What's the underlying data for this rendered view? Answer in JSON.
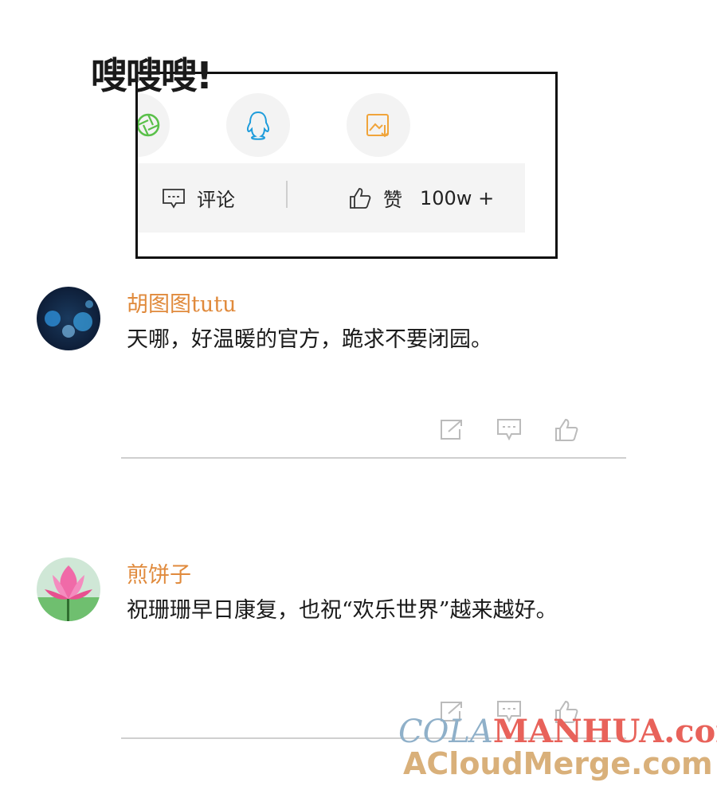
{
  "sfx_text": "嗖嗖嗖!",
  "share_panel": {
    "icons": [
      "wechat-moments-icon",
      "qq-icon",
      "save-image-icon"
    ],
    "comment_label": "评论",
    "like_label": "赞",
    "like_count": "100w +"
  },
  "comments": [
    {
      "username": "胡图图tutu",
      "text": "天哪，好温暖的官方，跪求不要闭园。"
    },
    {
      "username": "煎饼子",
      "text": "祝珊珊早日康复，也祝“欢乐世界”越来越好。"
    }
  ],
  "watermark": {
    "part1": "COLA",
    "part2": "MANHUA.com",
    "line2": "ACloudMerge.com"
  },
  "colors": {
    "username": "#e08a3c",
    "watermark_blue": "#8fb0c9",
    "watermark_red": "#e8625a",
    "watermark_gold": "#d9b07a"
  }
}
